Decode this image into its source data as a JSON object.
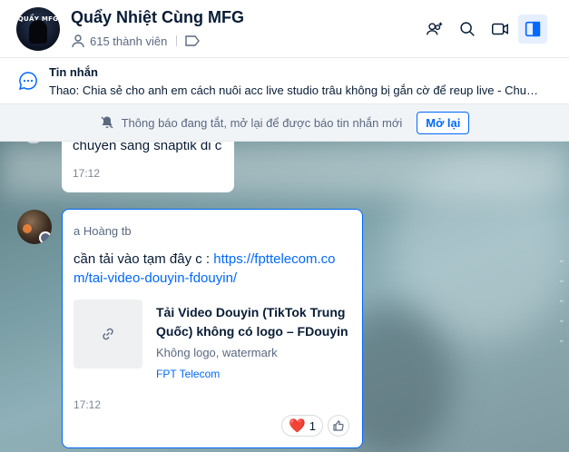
{
  "header": {
    "title": "Quẩy Nhiệt Cùng MFG",
    "members": "615 thành viên",
    "avatar_text": [
      "QUẨY MFG",
      "",
      ""
    ],
    "icons": [
      "add-member-icon",
      "search-icon",
      "video-call-icon",
      "sidebar-toggle-icon"
    ]
  },
  "topic": {
    "title": "Tin nhắn",
    "text": "Thao: Chia sẻ cho anh em cách nuôi acc live studio trâu không bị gắn cờ để reup live - Chuẩn ..."
  },
  "notification": {
    "text": "Thông báo đang tắt, mở lại để được báo tin nhắn mới",
    "button": "Mở lại"
  },
  "messages": [
    {
      "text": "chuyển sang snaptik đi c",
      "time": "17:12"
    },
    {
      "sender": "a Hoàng tb",
      "text_prefix": "cần tải vào tạm đây c : ",
      "link": "https://fpttelecom.com/tai-video-douyin-fdouyin/",
      "preview": {
        "title": "Tải Video Douyin (TikTok Trung Quốc) không có logo – FDouyin",
        "description": "Không logo, watermark",
        "domain": "FPT Telecom"
      },
      "time": "17:12",
      "reaction": {
        "emoji": "❤️",
        "count": "1"
      }
    }
  ],
  "colors": {
    "accent": "#0068ff",
    "text": "#081c36",
    "muted": "#5a6981"
  }
}
